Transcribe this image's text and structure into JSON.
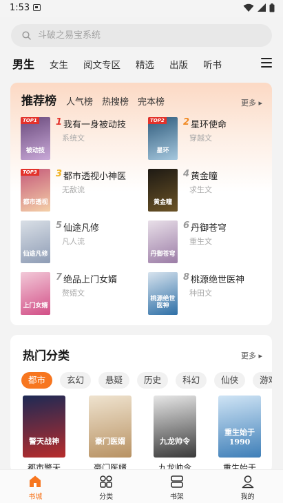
{
  "status_bar": {
    "time": "1:53"
  },
  "search": {
    "placeholder": "斗破之易宝系统"
  },
  "tabs": [
    "男生",
    "女生",
    "阅文专区",
    "精选",
    "出版",
    "听书"
  ],
  "rank": {
    "title": "推荐榜",
    "tabs": [
      "人气榜",
      "热搜榜",
      "完本榜"
    ],
    "more": "更多",
    "items": [
      {
        "num": "1",
        "name": "我有一身被动技",
        "genre": "系统文",
        "badge": "TOP1",
        "cover_text": "被动技",
        "num_color": "#e3322b",
        "c1": "#6a4a7c",
        "c2": "#c9a9d8"
      },
      {
        "num": "2",
        "name": "星环使命",
        "genre": "穿越文",
        "badge": "TOP2",
        "cover_text": "星环",
        "num_color": "#f08a24",
        "c1": "#2f5b7c",
        "c2": "#a6c8de"
      },
      {
        "num": "3",
        "name": "都市透视小神医",
        "genre": "无敌流",
        "badge": "TOP3",
        "cover_text": "都市透视",
        "num_color": "#f0b324",
        "c1": "#c55a7a",
        "c2": "#f4d0a8"
      },
      {
        "num": "4",
        "name": "黄金瞳",
        "genre": "求生文",
        "badge": "",
        "cover_text": "黄金瞳",
        "num_color": "#999999",
        "c1": "#1e1a14",
        "c2": "#6b5326"
      },
      {
        "num": "5",
        "name": "仙途凡修",
        "genre": "凡人流",
        "badge": "",
        "cover_text": "仙途凡修",
        "num_color": "#999999",
        "c1": "#d9dfe6",
        "c2": "#8e9cb5"
      },
      {
        "num": "6",
        "name": "丹御苍穹",
        "genre": "重生文",
        "badge": "",
        "cover_text": "丹御苍穹",
        "num_color": "#999999",
        "c1": "#e8dfe8",
        "c2": "#9b7ca6"
      },
      {
        "num": "7",
        "name": "绝品上门女婿",
        "genre": "赘婿文",
        "badge": "",
        "cover_text": "上门女婿",
        "num_color": "#999999",
        "c1": "#f2c9d8",
        "c2": "#d24f87"
      },
      {
        "num": "8",
        "name": "桃源绝世医神",
        "genre": "种田文",
        "badge": "",
        "cover_text": "桃源绝世医神",
        "num_color": "#999999",
        "c1": "#d7e3ee",
        "c2": "#2e6fa6"
      }
    ]
  },
  "categories": {
    "title": "热门分类",
    "more": "更多",
    "chips": [
      "都市",
      "玄幻",
      "悬疑",
      "历史",
      "科幻",
      "仙侠",
      "游戏"
    ],
    "books": [
      {
        "name": "都市警天",
        "cover_text": "警天战神",
        "c1": "#1d2a55",
        "c2": "#b72c2c"
      },
      {
        "name": "豪门医婿",
        "cover_text": "豪门医婿",
        "c1": "#efe3cf",
        "c2": "#b89263"
      },
      {
        "name": "九龙帅令",
        "cover_text": "九龙帅令",
        "c1": "#e6e6e6",
        "c2": "#3a3a3a"
      },
      {
        "name": "重生始于",
        "cover_text": "重生始于1990",
        "c1": "#cfe4f5",
        "c2": "#3f7fb8"
      }
    ]
  },
  "nav": [
    "书城",
    "分类",
    "书架",
    "我的"
  ],
  "colors": {
    "accent": "#f7761f",
    "top1": "#e3322b"
  }
}
